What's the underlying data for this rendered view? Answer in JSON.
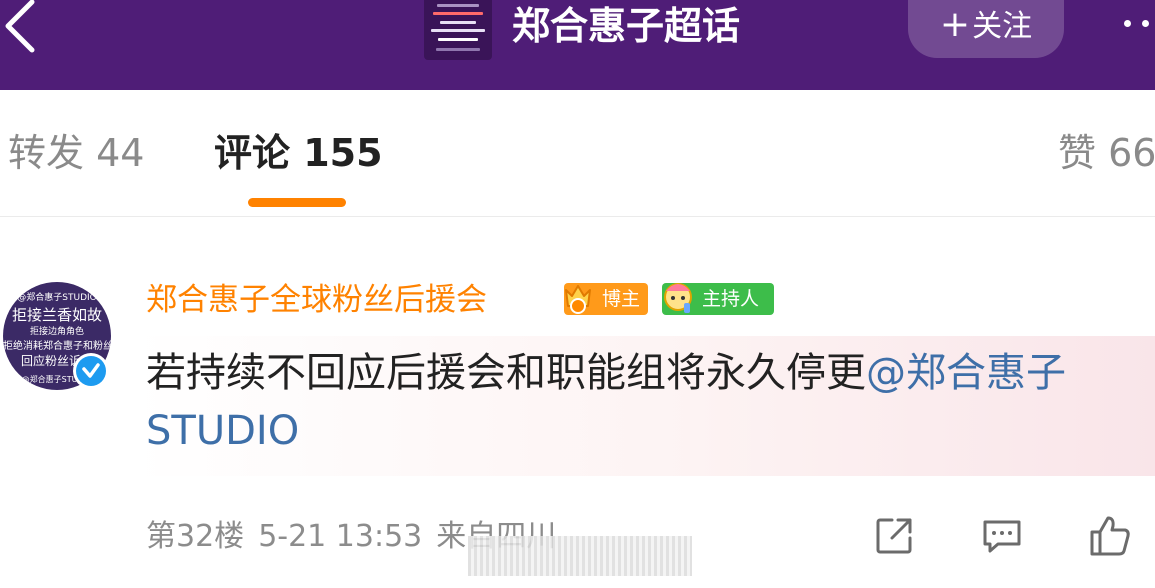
{
  "header": {
    "title": "郑合惠子超话",
    "follow_plus": "+",
    "follow_label": "关注",
    "thumbnail": {
      "lines": [
        "#ffffff",
        "#ff5a5a",
        "#ffffff",
        "#ffffff",
        "#ff5a5a",
        "#ffffff"
      ]
    }
  },
  "tabs": {
    "repost": "转发 44",
    "comment": "评论 155",
    "like": "赞 66"
  },
  "comment": {
    "avatar_lines": [
      "@郑合惠子STUDIO",
      "拒接兰香如故",
      "拒接边角角色",
      "拒绝消耗郑合惠子和粉丝",
      "回应粉丝诉求",
      "@郑合惠子STUDIO"
    ],
    "username": "郑合惠子全球粉丝后援会",
    "badge_blogger": "博主",
    "badge_host": "主持人",
    "text": "若持续不回应后援会和职能组将永久停更",
    "mention": "@郑合惠子STUDIO",
    "floor": "第32楼",
    "time": "5-21 13:53",
    "location": "来自四川"
  },
  "colors": {
    "header_bg": "#4f1d77",
    "accent_orange": "#ff8200",
    "mention_blue": "#3e6fa8",
    "host_green": "#3dbd4a",
    "verified_blue": "#1d9bf0"
  },
  "icons": [
    "back-arrow-icon",
    "more-dots-icon",
    "verified-icon",
    "crown-icon",
    "host-mascot-icon",
    "share-icon",
    "reply-icon",
    "like-icon"
  ]
}
